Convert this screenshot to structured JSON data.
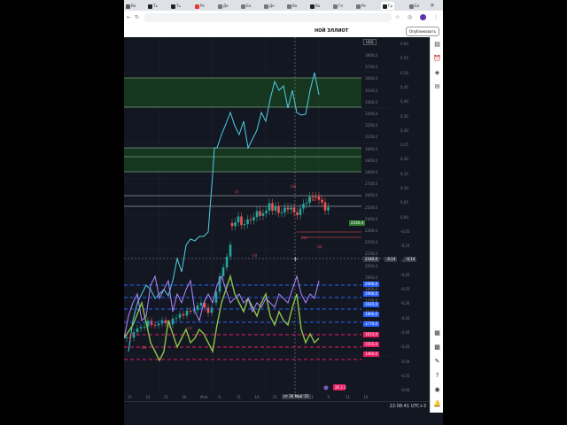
{
  "browser": {
    "tabs": [
      "Ва",
      "Ть",
      "Ть",
      "Ре",
      "Де",
      "Ба",
      "Де",
      "Ва",
      "Ва",
      "Ге",
      "Ре",
      "Гр",
      "Ба"
    ],
    "address": "",
    "publish_label": "Опубликовать"
  },
  "symbol": {
    "name": "НОЙ ЭЛЛИОТ",
    "currency": "USD"
  },
  "price_axis": {
    "labels": [
      "3800,0",
      "3700,0",
      "3600,0",
      "3500,0",
      "3400,0",
      "3300,0",
      "3200,0",
      "3100,0",
      "3000,0",
      "2900,0",
      "2800,0",
      "2700,0",
      "2600,0",
      "2500,0",
      "2400,0",
      "2300,0",
      "2200,0",
      "2100,0",
      "2000,0",
      "1900,0",
      "1800,0",
      "1700,0",
      "1600,0",
      "1500,0",
      "1400,0"
    ],
    "right_labels": [
      "0,60",
      "0,55",
      "0,50",
      "0,45",
      "0,40",
      "0,35",
      "0,30",
      "0,25",
      "0,20",
      "0,15",
      "0,10",
      "0,05",
      "0,00",
      "-0,05",
      "-0,10",
      "-0,15",
      "-0,20",
      "-0,25",
      "-0,30",
      "-0,35",
      "-0,40",
      "-0,45",
      "-0,50",
      "-0,55",
      "-0,60"
    ],
    "current_price_label": "2336,4",
    "crosshair_price": "2340,0",
    "crosshair_values": [
      "-0,14",
      "-0,14"
    ],
    "level_labels": [
      "2066,0",
      "1966,0",
      "1920,0",
      "1866,0",
      "1770,0",
      "1653,0",
      "1555,0",
      "1460,0"
    ],
    "colors": {
      "up": "#26a69a",
      "down": "#ef5350",
      "line": "#4dd0e1",
      "green_line": "#8bc34a",
      "purple_line": "#b388ff",
      "zone": "#1b5e20"
    }
  },
  "time_axis": {
    "labels": [
      "11",
      "16",
      "21",
      "26",
      "Май",
      "6",
      "11",
      "16",
      "21",
      "26",
      "31",
      "6",
      "11",
      "16"
    ],
    "crosshair_date": "пт 30 Май '25"
  },
  "status": {
    "clock": "22:08:41 UTC+3"
  },
  "waves": [
    "(i)",
    "(ii)",
    "(iii)",
    "(iv)",
    "(v)",
    "(a)",
    "(b)",
    "(c)"
  ],
  "badge": "26 2 2"
}
